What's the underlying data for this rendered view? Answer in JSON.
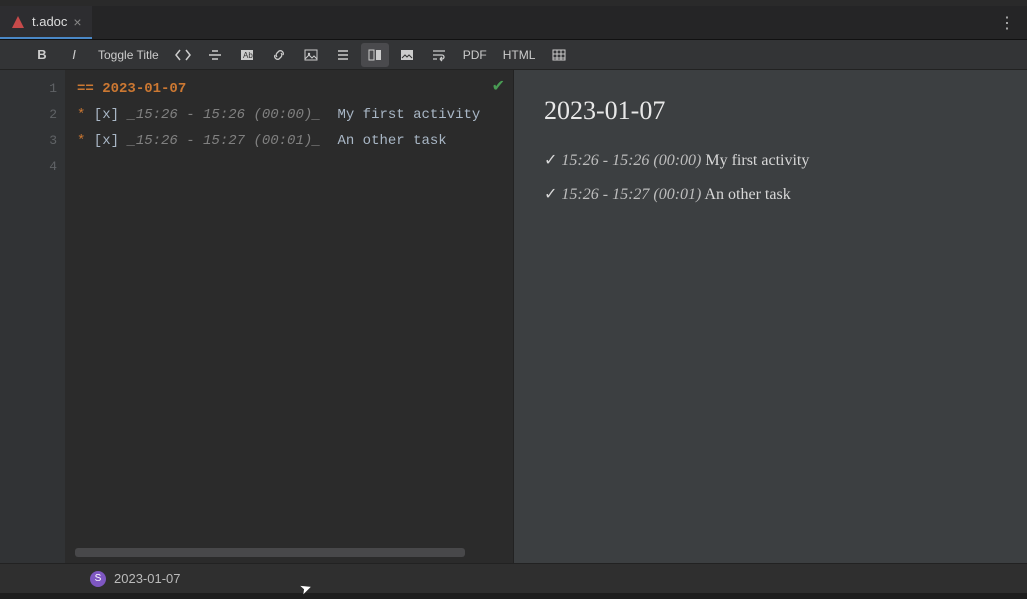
{
  "tab": {
    "filename": "t.adoc"
  },
  "toolbar": {
    "toggle_title": "Toggle Title",
    "pdf": "PDF",
    "html": "HTML"
  },
  "editor": {
    "lines": [
      "1",
      "2",
      "3",
      "4"
    ],
    "heading_prefix": "== ",
    "heading": "2023-01-07",
    "row1_bullet": "*",
    "row1_check": " [x] ",
    "row1_time": "_15:26 - 15:26 (00:00)_",
    "row1_text": "  My first activity",
    "row2_bullet": "*",
    "row2_check": " [x] ",
    "row2_time": "_15:26 - 15:27 (00:01)_",
    "row2_text": "  An other task"
  },
  "preview": {
    "title": "2023-01-07",
    "items": [
      {
        "check": "✓",
        "time": "15:26 - 15:26 (00:00)",
        "text": " My first activity"
      },
      {
        "check": "✓",
        "time": "15:26 - 15:27 (00:01)",
        "text": " An other task"
      }
    ]
  },
  "breadcrumb": {
    "badge": "S",
    "text": "2023-01-07"
  }
}
